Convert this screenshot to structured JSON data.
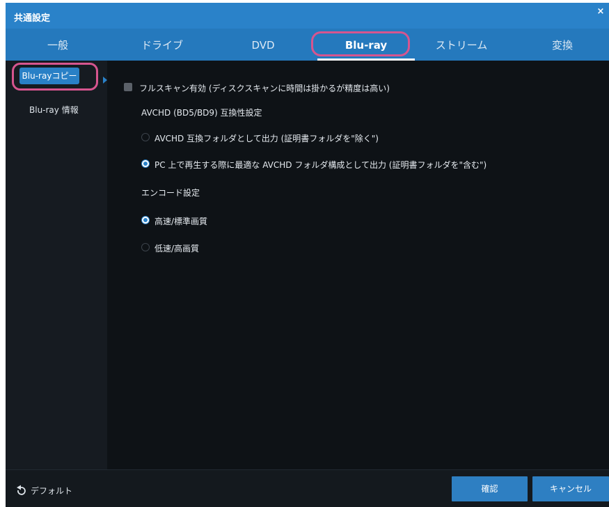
{
  "window": {
    "title": "共通設定",
    "close_glyph": "×"
  },
  "tabs": [
    {
      "label": "一般",
      "active": false
    },
    {
      "label": "ドライブ",
      "active": false
    },
    {
      "label": "DVD",
      "active": false
    },
    {
      "label": "Blu-ray",
      "active": true
    },
    {
      "label": "ストリーム",
      "active": false
    },
    {
      "label": "変換",
      "active": false
    }
  ],
  "sidebar": {
    "items": [
      {
        "label": "Blu-rayコピー",
        "active": true
      },
      {
        "label": "Blu-ray 情報",
        "active": false
      }
    ]
  },
  "settings": {
    "full_scan": {
      "label": "フルスキャン有効 (ディスクスキャンに時間は掛かるが精度は高い)",
      "checked": false
    },
    "avchd_heading": "AVCHD (BD5/BD9) 互換性設定",
    "avchd_options": [
      {
        "label": "AVCHD 互換フォルダとして出力 (証明書フォルダを\"除く\")",
        "checked": false
      },
      {
        "label": "PC 上で再生する際に最適な AVCHD フォルダ構成として出力 (証明書フォルダを\"含む\")",
        "checked": true
      }
    ],
    "encode_heading": "エンコード設定",
    "encode_options": [
      {
        "label": "高速/標準画質",
        "checked": true
      },
      {
        "label": "低速/高画質",
        "checked": false
      }
    ]
  },
  "footer": {
    "default_label": "デフォルト",
    "confirm_label": "確認",
    "cancel_label": "キャンセル"
  },
  "colors": {
    "titlebar": "#2a82c9",
    "tabbar": "#2579bd",
    "background": "#0e1216",
    "sidebar": "#161b21",
    "accent": "#2a82c9",
    "annotation_highlight": "#d6558f"
  }
}
